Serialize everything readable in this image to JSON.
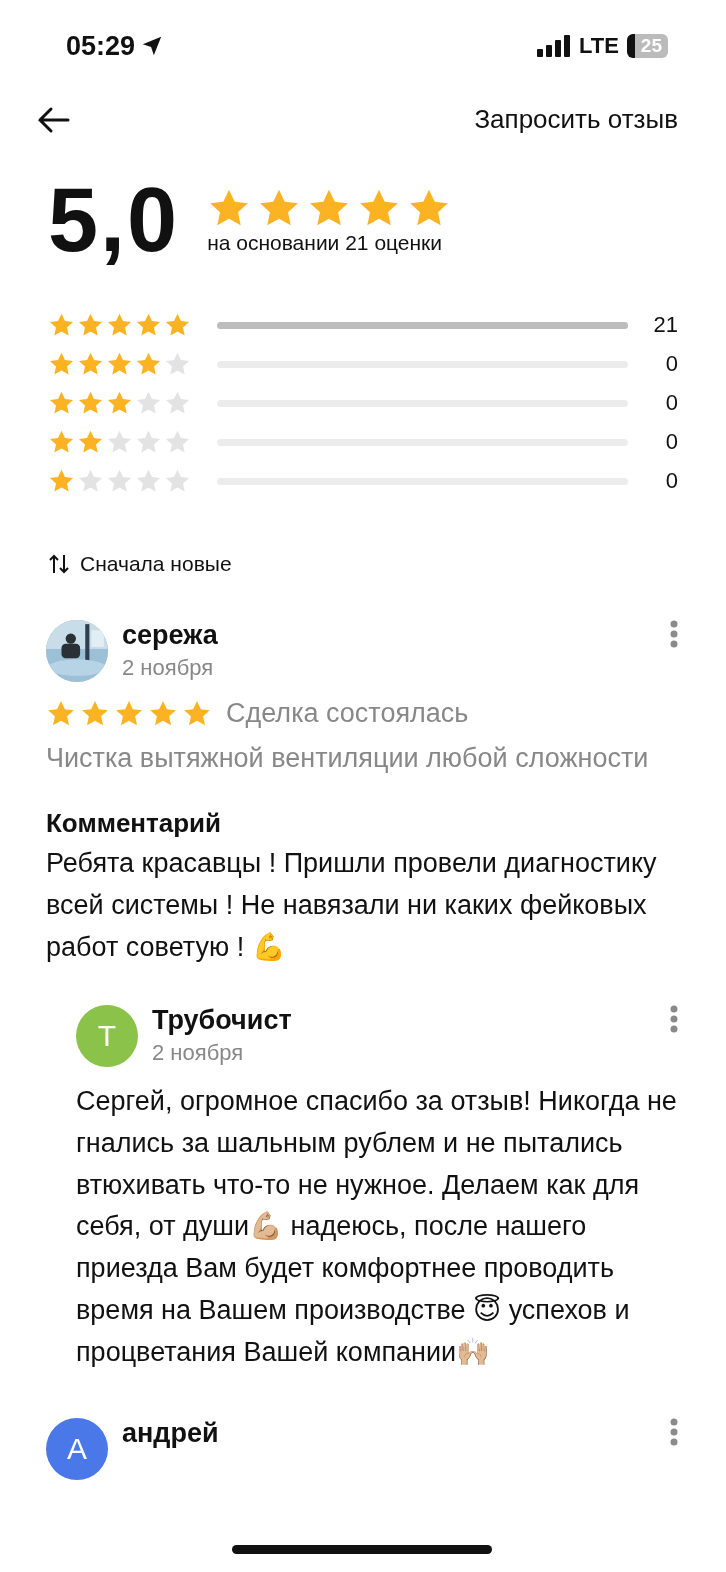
{
  "status_bar": {
    "time": "05:29",
    "network": "LTE",
    "battery": "25"
  },
  "header": {
    "action": "Запросить отзыв"
  },
  "summary": {
    "score": "5,0",
    "stars": 5,
    "caption": "на основании 21 оценки"
  },
  "distribution": [
    {
      "stars": 5,
      "level": 1,
      "count": "21"
    },
    {
      "stars": 4,
      "level": 0,
      "count": "0"
    },
    {
      "stars": 3,
      "level": 0,
      "count": "0"
    },
    {
      "stars": 2,
      "level": 0,
      "count": "0"
    },
    {
      "stars": 1,
      "level": 0,
      "count": "0"
    }
  ],
  "sort": {
    "label": "Сначала новые"
  },
  "reviews": [
    {
      "name": "сережа",
      "date": "2 ноября",
      "stars": 5,
      "status": "Сделка состоялась",
      "service": "Чистка вытяжной вентиляции любой сложности",
      "comment_title": "Комментарий",
      "comment": "Ребята красавцы ! Пришли провели диагностику всей системы ! Не навязали ни каких фейковых работ советую ! 💪",
      "reply": {
        "avatar": {
          "kind": "letter",
          "letter": "Т",
          "color": "#8bc34a"
        },
        "name": "Трубочист",
        "date": "2 ноября",
        "text": "Сергей, огромное спасибо за отзыв! Никогда не гнались за шальным рублем и не пытались втюхивать что-то не нужное. Делаем как для себя, от души💪🏼 надеюсь, после нашего приезда Вам будет комфортнее проводить время на Вашем производстве 😇 успехов и процветания Вашей компании🙌🏼"
      }
    },
    {
      "avatar": {
        "kind": "letter",
        "letter": "А",
        "color": "#4a78e8"
      },
      "name": "андрей"
    }
  ]
}
